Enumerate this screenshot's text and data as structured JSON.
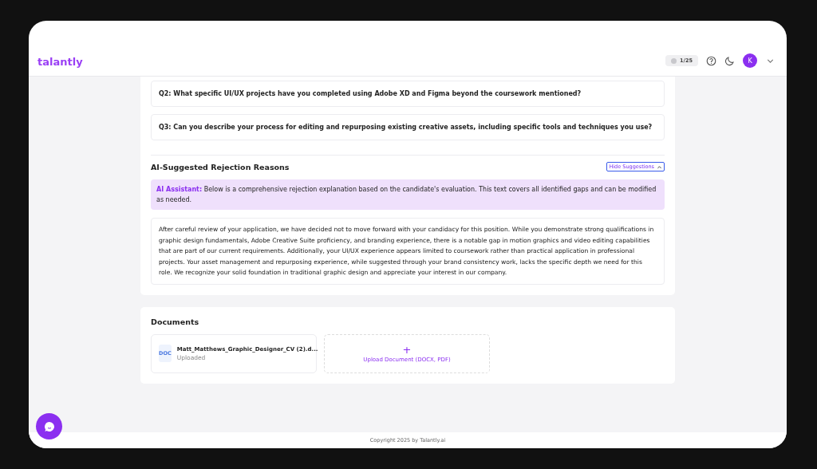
{
  "header": {
    "logo": "talantly",
    "credits": {
      "label": "1/25"
    },
    "avatar": {
      "initial": "K"
    }
  },
  "questions": [
    {
      "text": "Q2: What specific UI/UX projects have you completed using Adobe XD and Figma beyond the coursework mentioned?"
    },
    {
      "text": "Q3: Can you describe your process for editing and repurposing existing creative assets, including specific tools and techniques you use?"
    }
  ],
  "rejection": {
    "title": "AI-Suggested Rejection Reasons",
    "toggle": {
      "label": "Hide Suggestions",
      "expanded": true
    },
    "assistant_note": "**AI Assistant:** Below is a comprehensive rejection explanation based on the candidate's evaluation. This text covers all identified gaps and can be modified as needed.",
    "text": "After careful review of your application, we have decided not to move forward with your candidacy for this position. While you demonstrate strong qualifications in graphic design fundamentals, Adobe Creative Suite proficiency, and branding experience, there is a notable gap in motion graphics and video editing capabilities that are part of our current requirements. Additionally, your UI/UX experience appears limited to coursework rather than practical application in professional projects. Your asset management and repurposing experience, while suggested through your brand consistency work, lacks the specific depth we need for this role. We recognize your solid foundation in traditional graphic design and appreciate your interest in our company."
  },
  "documents": {
    "title": "Documents",
    "files": [
      {
        "type": "DOC",
        "name": "Matt_Matthews_Graphic_Designer_CV (2).d...",
        "status": "Uploaded"
      }
    ],
    "upload": {
      "icon": "+",
      "label": "Upload Document (DOCX, PDF)"
    }
  },
  "footer": "Copyright 2025 by Talantly.ai"
}
